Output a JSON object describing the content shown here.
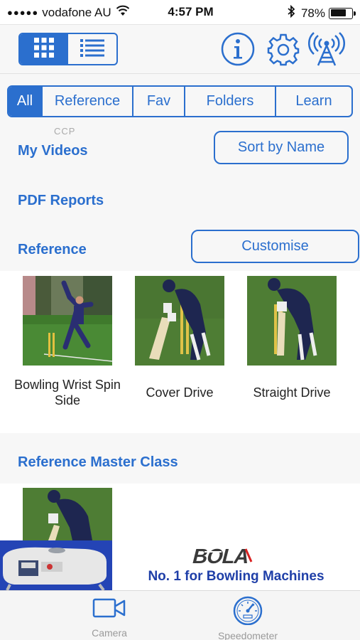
{
  "status_bar": {
    "signal": "●●●●●",
    "carrier": "vodafone AU",
    "time": "4:57 PM",
    "battery_percent": "78%",
    "battery_level": 0.78
  },
  "toolbar": {
    "view_modes": [
      "grid-icon",
      "list-icon"
    ],
    "active_view": "grid",
    "actions": [
      "info-icon",
      "gear-icon",
      "broadcast-icon"
    ]
  },
  "tabs": {
    "items": [
      "All",
      "Reference",
      "Fav",
      "Folders",
      "Learn"
    ],
    "active": "All"
  },
  "sections": {
    "ccp_label": "CCP",
    "my_videos": "My Videos",
    "sort_button": "Sort by Name",
    "pdf_reports": "PDF Reports",
    "reference": "Reference",
    "customise_button": "Customise",
    "reference_master_class": "Reference Master Class"
  },
  "reference_videos": [
    {
      "title": "Bowling Wrist Spin Side"
    },
    {
      "title": "Cover Drive"
    },
    {
      "title": "Straight Drive"
    }
  ],
  "ad": {
    "logo_text": "BOLA",
    "tagline": "No. 1 for Bowling Machines"
  },
  "tab_bar": {
    "items": [
      {
        "label": "Camera",
        "icon": "camera-icon"
      },
      {
        "label": "Speedometer",
        "icon": "speedometer-icon"
      }
    ]
  },
  "colors": {
    "accent": "#2b6fce",
    "ad_blue": "#1f3fa8",
    "background": "#f7f7f7"
  }
}
